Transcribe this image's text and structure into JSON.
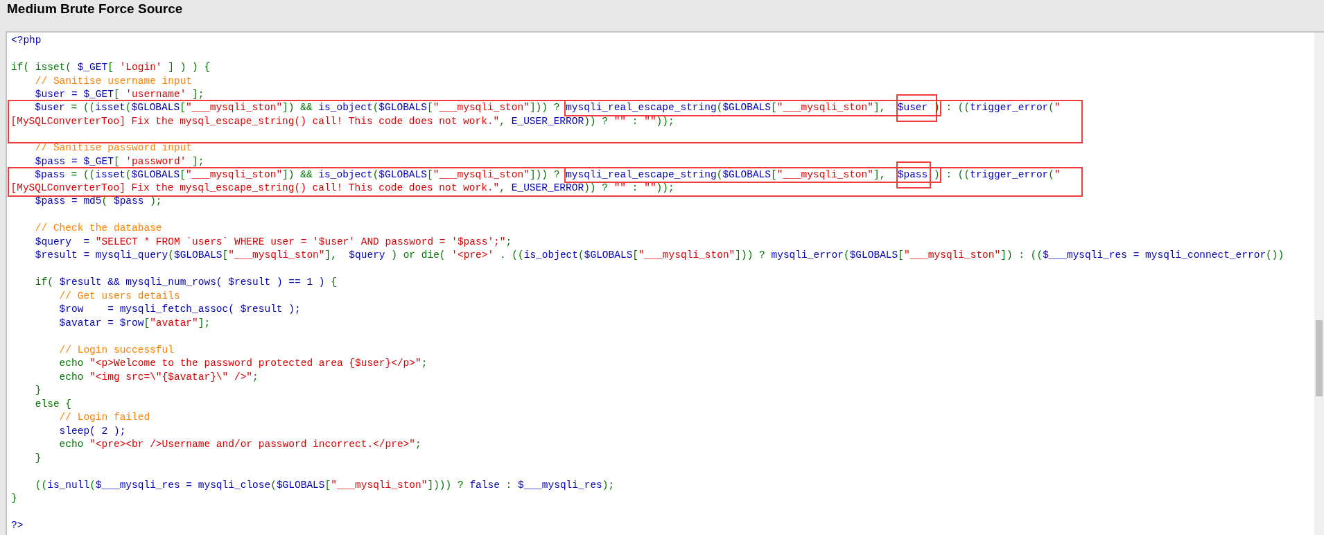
{
  "title": "Medium Brute Force Source",
  "blocks": [
    {
      "outlined": false,
      "lines": [
        [
          {
            "kind": "var",
            "text": "<?php"
          }
        ],
        {
          "kind": "blank"
        },
        [
          {
            "kind": "kw",
            "text": "if( isset( "
          },
          {
            "kind": "var",
            "text": "$_GET"
          },
          {
            "kind": "kw",
            "text": "[ "
          },
          {
            "kind": "str",
            "text": "'Login'"
          },
          {
            "kind": "kw",
            "text": " ] ) ) {"
          }
        ],
        [
          {
            "kind": "cmt",
            "text": "    // Sanitise username input"
          }
        ],
        [
          {
            "kind": "var",
            "text": "    $user = $_GET"
          },
          {
            "kind": "kw",
            "text": "[ "
          },
          {
            "kind": "str",
            "text": "'username'"
          },
          {
            "kind": "kw",
            "text": " ];"
          }
        ]
      ]
    },
    {
      "outlined": true,
      "lines": [
        [
          {
            "kind": "var",
            "text": "    $user "
          },
          {
            "kind": "kw",
            "text": "= (("
          },
          {
            "kind": "var",
            "text": "isset"
          },
          {
            "kind": "kw",
            "text": "("
          },
          {
            "kind": "var",
            "text": "$GLOBALS"
          },
          {
            "kind": "kw",
            "text": "["
          },
          {
            "kind": "str",
            "text": "\"___mysqli_ston\""
          },
          {
            "kind": "kw",
            "text": "]) && "
          },
          {
            "kind": "var",
            "text": "is_object"
          },
          {
            "kind": "kw",
            "text": "("
          },
          {
            "kind": "var",
            "text": "$GLOBALS"
          },
          {
            "kind": "kw",
            "text": "["
          },
          {
            "kind": "str",
            "text": "\"___mysqli_ston\""
          },
          {
            "kind": "kw",
            "text": "])) ? "
          },
          {
            "kind": "box",
            "tokens": [
              {
                "kind": "var",
                "text": "mysqli_real_escape_string"
              },
              {
                "kind": "kw",
                "text": "("
              },
              {
                "kind": "var",
                "text": "$GLOBALS"
              },
              {
                "kind": "kw",
                "text": "["
              },
              {
                "kind": "str",
                "text": "\"___mysqli_ston\""
              },
              {
                "kind": "kw",
                "text": "],  "
              },
              {
                "kind": "tallbox",
                "tokens": [
                  {
                    "kind": "var",
                    "text": "$user "
                  }
                ]
              },
              {
                "kind": "kw",
                "text": ")"
              }
            ]
          },
          {
            "kind": "kw",
            "text": " : (("
          },
          {
            "kind": "var",
            "text": "trigger_error"
          },
          {
            "kind": "kw",
            "text": "("
          },
          {
            "kind": "str",
            "text": "\""
          }
        ],
        [
          {
            "kind": "str",
            "text": "[MySQLConverterToo] Fix the mysql_escape_string() call! This code does not work.\""
          },
          {
            "kind": "kw",
            "text": ", "
          },
          {
            "kind": "var",
            "text": "E_USER_ERROR"
          },
          {
            "kind": "kw",
            "text": ")) ? "
          },
          {
            "kind": "str",
            "text": "\"\""
          },
          {
            "kind": "kw",
            "text": " : "
          },
          {
            "kind": "str",
            "text": "\"\""
          },
          {
            "kind": "kw",
            "text": "));"
          }
        ],
        {
          "kind": "blank"
        }
      ]
    },
    {
      "outlined": false,
      "lines": [
        [
          {
            "kind": "cmt",
            "text": "    // Sanitise password input"
          }
        ],
        [
          {
            "kind": "var",
            "text": "    $pass = $_GET"
          },
          {
            "kind": "kw",
            "text": "[ "
          },
          {
            "kind": "str",
            "text": "'password'"
          },
          {
            "kind": "kw",
            "text": " ];"
          }
        ]
      ]
    },
    {
      "outlined": true,
      "lines": [
        [
          {
            "kind": "var",
            "text": "    $pass "
          },
          {
            "kind": "kw",
            "text": "= (("
          },
          {
            "kind": "var",
            "text": "isset"
          },
          {
            "kind": "kw",
            "text": "("
          },
          {
            "kind": "var",
            "text": "$GLOBALS"
          },
          {
            "kind": "kw",
            "text": "["
          },
          {
            "kind": "str",
            "text": "\"___mysqli_ston\""
          },
          {
            "kind": "kw",
            "text": "]) && "
          },
          {
            "kind": "var",
            "text": "is_object"
          },
          {
            "kind": "kw",
            "text": "("
          },
          {
            "kind": "var",
            "text": "$GLOBALS"
          },
          {
            "kind": "kw",
            "text": "["
          },
          {
            "kind": "str",
            "text": "\"___mysqli_ston\""
          },
          {
            "kind": "kw",
            "text": "])) ? "
          },
          {
            "kind": "box",
            "tokens": [
              {
                "kind": "var",
                "text": "mysqli_real_escape_string"
              },
              {
                "kind": "kw",
                "text": "("
              },
              {
                "kind": "var",
                "text": "$GLOBALS"
              },
              {
                "kind": "kw",
                "text": "["
              },
              {
                "kind": "str",
                "text": "\"___mysqli_ston\""
              },
              {
                "kind": "kw",
                "text": "],  "
              },
              {
                "kind": "tallbox",
                "tokens": [
                  {
                    "kind": "var",
                    "text": "$pass"
                  }
                ]
              },
              {
                "kind": "kw",
                "text": " )"
              }
            ]
          },
          {
            "kind": "kw",
            "text": " : (("
          },
          {
            "kind": "var",
            "text": "trigger_error"
          },
          {
            "kind": "kw",
            "text": "("
          },
          {
            "kind": "str",
            "text": "\""
          }
        ],
        [
          {
            "kind": "str",
            "text": "[MySQLConverterToo] Fix the mysql_escape_string() call! This code does not work.\""
          },
          {
            "kind": "kw",
            "text": ", "
          },
          {
            "kind": "var",
            "text": "E_USER_ERROR"
          },
          {
            "kind": "kw",
            "text": ")) ? "
          },
          {
            "kind": "str",
            "text": "\"\""
          },
          {
            "kind": "kw",
            "text": " : "
          },
          {
            "kind": "str",
            "text": "\"\""
          },
          {
            "kind": "kw",
            "text": "));"
          }
        ]
      ]
    },
    {
      "outlined": false,
      "lines": [
        [
          {
            "kind": "var",
            "text": "    $pass = md5"
          },
          {
            "kind": "kw",
            "text": "( "
          },
          {
            "kind": "var",
            "text": "$pass"
          },
          {
            "kind": "kw",
            "text": " );"
          }
        ],
        {
          "kind": "blank"
        },
        [
          {
            "kind": "cmt",
            "text": "    // Check the database"
          }
        ],
        [
          {
            "kind": "var",
            "text": "    $query  = "
          },
          {
            "kind": "str",
            "text": "\"SELECT * FROM `users` WHERE user = '$user' AND password = '$pass';\""
          },
          {
            "kind": "kw",
            "text": ";"
          }
        ],
        [
          {
            "kind": "var",
            "text": "    $result = mysqli_query"
          },
          {
            "kind": "kw",
            "text": "("
          },
          {
            "kind": "var",
            "text": "$GLOBALS"
          },
          {
            "kind": "kw",
            "text": "["
          },
          {
            "kind": "str",
            "text": "\"___mysqli_ston\""
          },
          {
            "kind": "kw",
            "text": "],  "
          },
          {
            "kind": "var",
            "text": "$query"
          },
          {
            "kind": "kw",
            "text": " ) or die( "
          },
          {
            "kind": "str",
            "text": "'<pre>'"
          },
          {
            "kind": "kw",
            "text": " . (("
          },
          {
            "kind": "var",
            "text": "is_object"
          },
          {
            "kind": "kw",
            "text": "("
          },
          {
            "kind": "var",
            "text": "$GLOBALS"
          },
          {
            "kind": "kw",
            "text": "["
          },
          {
            "kind": "str",
            "text": "\"___mysqli_ston\""
          },
          {
            "kind": "kw",
            "text": "])) ? "
          },
          {
            "kind": "var",
            "text": "mysqli_error"
          },
          {
            "kind": "kw",
            "text": "("
          },
          {
            "kind": "var",
            "text": "$GLOBALS"
          },
          {
            "kind": "kw",
            "text": "["
          },
          {
            "kind": "str",
            "text": "\"___mysqli_ston\""
          },
          {
            "kind": "kw",
            "text": "]) : (("
          },
          {
            "kind": "var",
            "text": "$___mysqli_res = mysqli_connect_error"
          },
          {
            "kind": "kw",
            "text": "())"
          }
        ],
        {
          "kind": "blank"
        },
        [
          {
            "kind": "kw",
            "text": "    if( "
          },
          {
            "kind": "var",
            "text": "$result && mysqli_num_rows( $result ) == 1 ) "
          },
          {
            "kind": "kw",
            "text": "{"
          }
        ],
        [
          {
            "kind": "cmt",
            "text": "        // Get users details"
          }
        ],
        [
          {
            "kind": "var",
            "text": "        $row    = mysqli_fetch_assoc( $result );"
          }
        ],
        [
          {
            "kind": "var",
            "text": "        $avatar = $row"
          },
          {
            "kind": "kw",
            "text": "["
          },
          {
            "kind": "str",
            "text": "\"avatar\""
          },
          {
            "kind": "kw",
            "text": "];"
          }
        ],
        {
          "kind": "blank"
        },
        [
          {
            "kind": "cmt",
            "text": "        // Login successful"
          }
        ],
        [
          {
            "kind": "kw",
            "text": "        echo "
          },
          {
            "kind": "str",
            "text": "\"<p>Welcome to the password protected area {$user}</p>\""
          },
          {
            "kind": "kw",
            "text": ";"
          }
        ],
        [
          {
            "kind": "kw",
            "text": "        echo "
          },
          {
            "kind": "str",
            "text": "\"<img src=\\\"{$avatar}\\\" />\""
          },
          {
            "kind": "kw",
            "text": ";"
          }
        ],
        [
          {
            "kind": "kw",
            "text": "    }"
          }
        ],
        [
          {
            "kind": "kw",
            "text": "    else {"
          }
        ],
        [
          {
            "kind": "cmt",
            "text": "        // Login failed"
          }
        ],
        [
          {
            "kind": "var",
            "text": "        sleep( 2 );"
          }
        ],
        [
          {
            "kind": "kw",
            "text": "        echo "
          },
          {
            "kind": "str",
            "text": "\"<pre><br />Username and/or password incorrect.</pre>\""
          },
          {
            "kind": "kw",
            "text": ";"
          }
        ],
        [
          {
            "kind": "kw",
            "text": "    }"
          }
        ],
        {
          "kind": "blank"
        },
        [
          {
            "kind": "kw",
            "text": "    (("
          },
          {
            "kind": "var",
            "text": "is_null"
          },
          {
            "kind": "kw",
            "text": "("
          },
          {
            "kind": "var",
            "text": "$___mysqli_res = mysqli_close"
          },
          {
            "kind": "kw",
            "text": "("
          },
          {
            "kind": "var",
            "text": "$GLOBALS"
          },
          {
            "kind": "kw",
            "text": "["
          },
          {
            "kind": "str",
            "text": "\"___mysqli_ston\""
          },
          {
            "kind": "kw",
            "text": "]))) ? "
          },
          {
            "kind": "var",
            "text": "false"
          },
          {
            "kind": "kw",
            "text": " : "
          },
          {
            "kind": "var",
            "text": "$___mysqli_res"
          },
          {
            "kind": "kw",
            "text": ");"
          }
        ],
        [
          {
            "kind": "kw",
            "text": "}"
          }
        ],
        {
          "kind": "blank"
        },
        [
          {
            "kind": "var",
            "text": "?>"
          }
        ]
      ]
    }
  ]
}
